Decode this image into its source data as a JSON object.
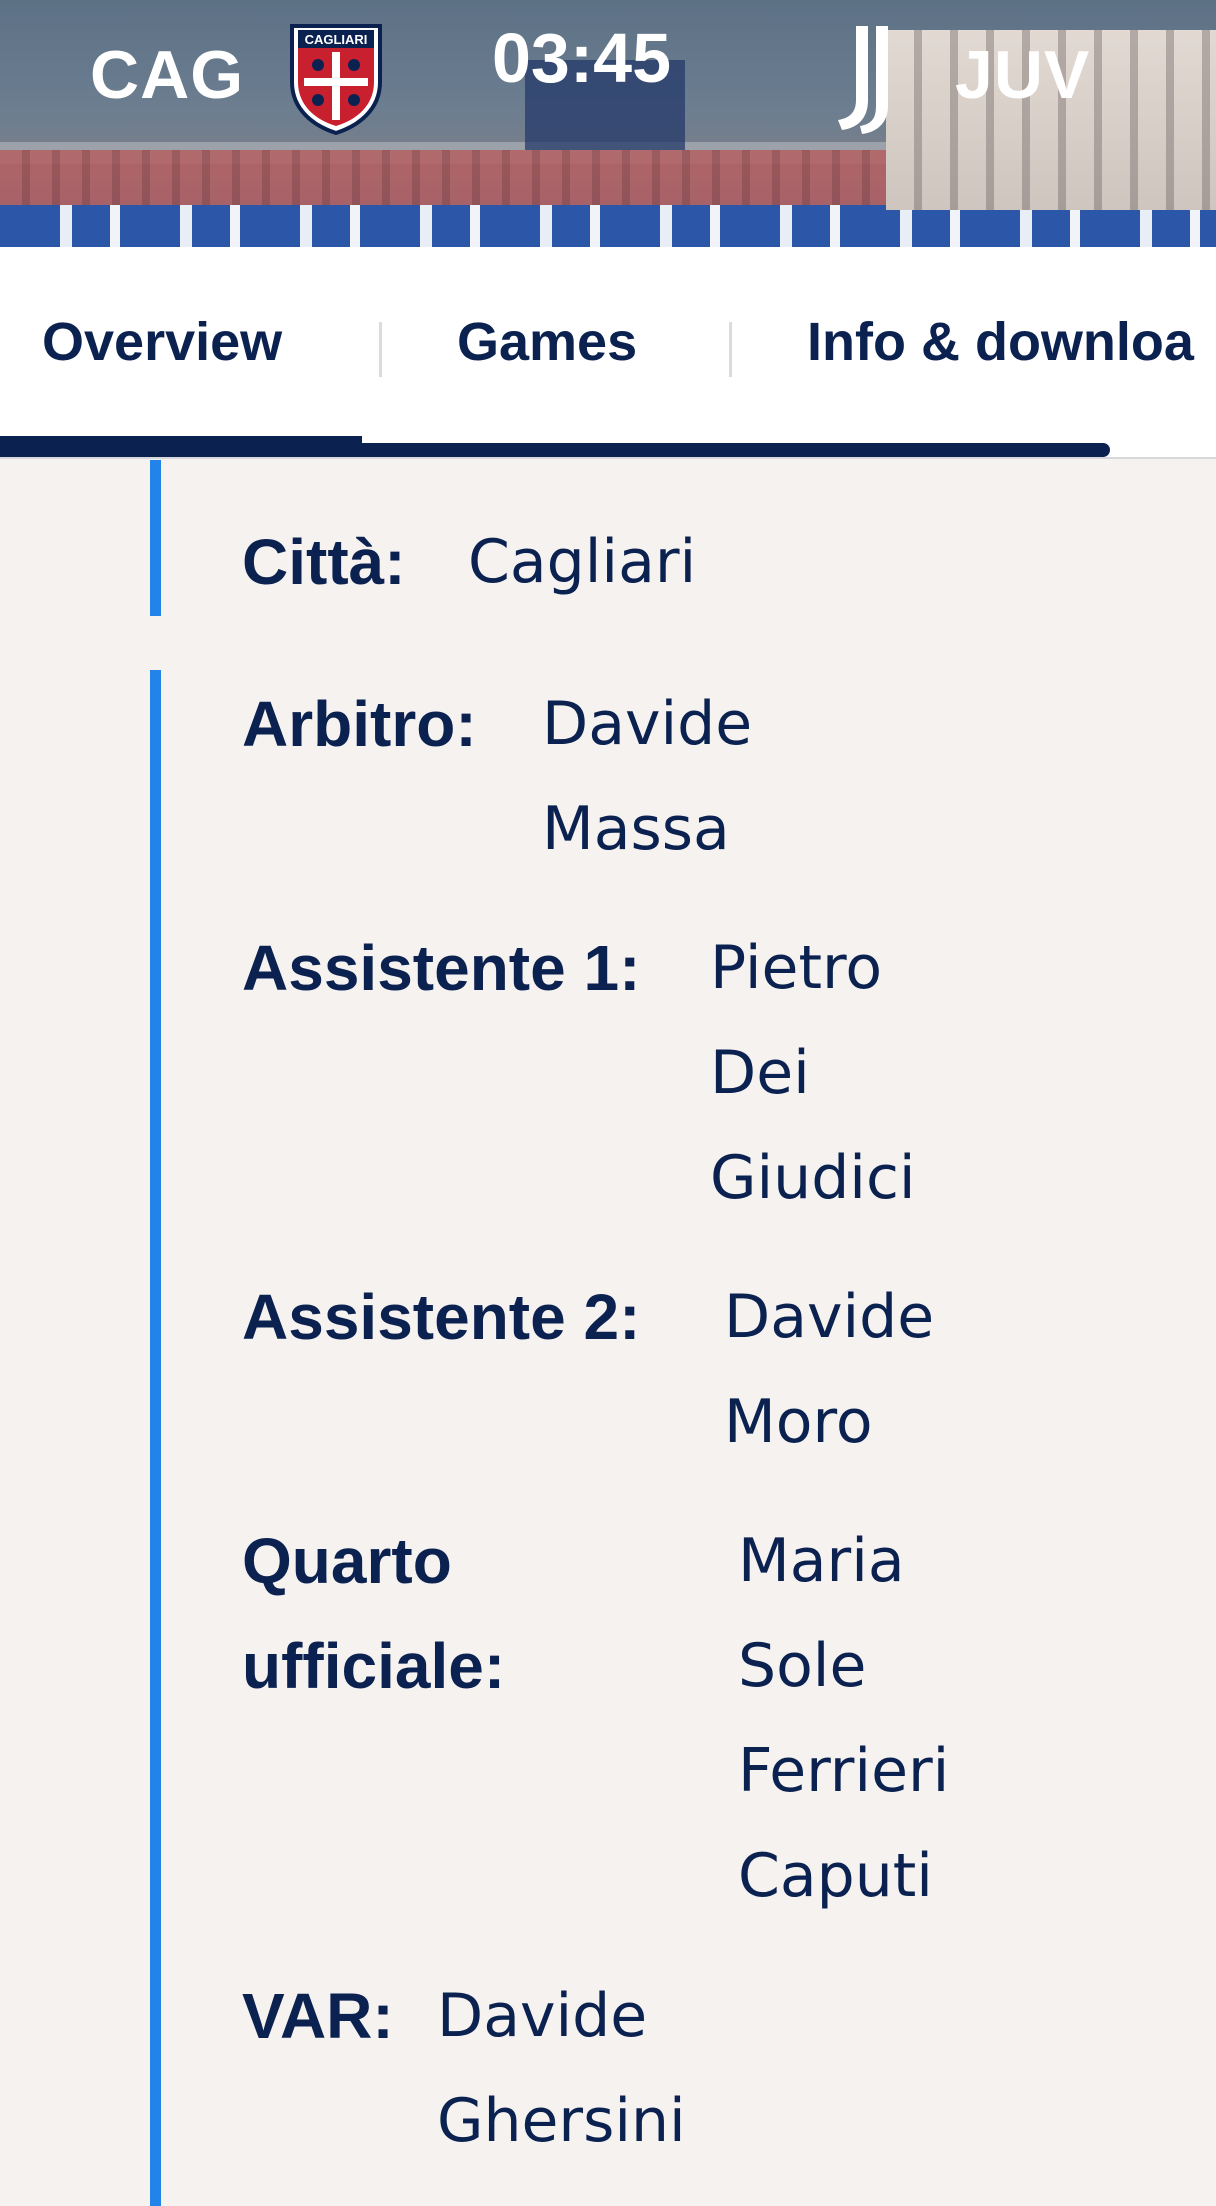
{
  "match": {
    "home_abbr": "CAG",
    "away_abbr": "JUV",
    "clock": "03:45",
    "home_logo_text": "CAGLIARI"
  },
  "tabs": [
    {
      "label": "Overview",
      "active": true
    },
    {
      "label": "Games",
      "active": false
    },
    {
      "label": "Info & downloa",
      "active": false
    }
  ],
  "details": {
    "city_label": "Città:",
    "city_value": "Cagliari",
    "officials": [
      {
        "label": "Arbitro:",
        "lines": [
          "Davide",
          "Massa"
        ]
      },
      {
        "label": "Assistente 1:",
        "lines": [
          "Pietro",
          "Dei",
          "Giudici"
        ]
      },
      {
        "label": "Assistente 2:",
        "lines": [
          "Davide",
          "Moro"
        ]
      },
      {
        "label_lines": [
          "Quarto",
          "ufficiale:"
        ],
        "lines": [
          "Maria",
          "Sole",
          "Ferrieri",
          "Caputi"
        ]
      },
      {
        "label": "VAR:",
        "lines": [
          "Davide",
          "Ghersini"
        ]
      }
    ]
  },
  "colors": {
    "navy": "#0b2250",
    "accent_blue": "#2284e8",
    "background": "#f5f2f0"
  }
}
